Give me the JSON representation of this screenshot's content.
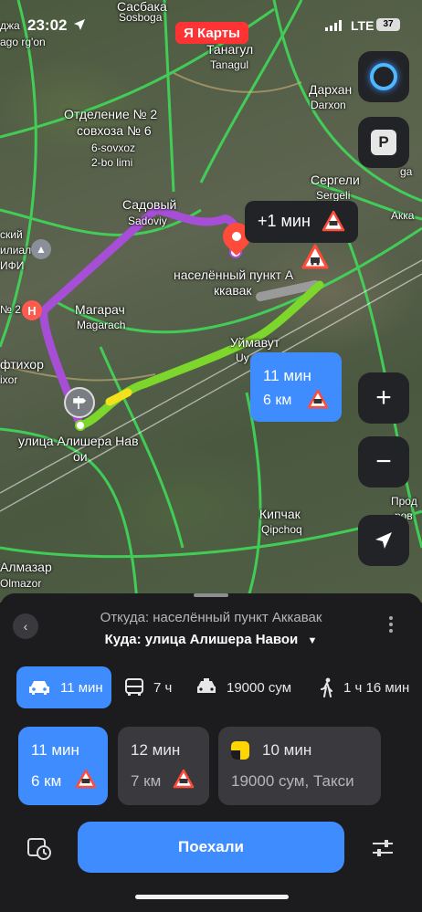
{
  "status_bar": {
    "time": "23:02",
    "network": "LTE",
    "battery": "37"
  },
  "app_logo": "Я Карты",
  "map": {
    "labels": {
      "sasbaka": "Сасбака",
      "sosboga": "Sosboga",
      "tanagul": "Танагул",
      "tanagul_lat": "Tanagul",
      "darkhan": "Дархан",
      "darxon": "Darxon",
      "ago_rgon": "ago rg'on",
      "dzha": "джа",
      "otdelenie1": "Отделение № 2",
      "otdelenie2": "совхоза № 6",
      "sovxoz1": "6-sovxoz",
      "sovxoz2": "2-bo limi",
      "sergeli": "Сергели",
      "sergeli_lat": "Sergeli",
      "akka": "Акка",
      "ga": "ga",
      "sadovy": "Садовый",
      "sadoviy": "Sadoviy",
      "skiy": "ский",
      "filial": "илиал",
      "ifi": "ИФИ",
      "magarach": "Магарач",
      "magarach_lat": "Magarach",
      "num2": "№ 2",
      "iftikhor": "фтихор",
      "ixor": "ixor",
      "uymavut": "Уймавут",
      "uy": "Uy",
      "street1": "улица Алишера Нав",
      "street2": "ои",
      "kipchak": "Кипчак",
      "qipchoq": "Qipchoq",
      "almazar": "Алмазар",
      "olmazor": "Olmazor",
      "prod": "Прод",
      "rod": "ров",
      "settlement1": "населённый пункт А",
      "settlement2": "ккавак"
    },
    "alt_route_bubble": "+1 мин",
    "route_bubble": {
      "time": "11 мин",
      "distance": "6 км"
    },
    "buttons": {
      "zoom_in": "+",
      "zoom_out": "−",
      "parking": "P"
    }
  },
  "panel": {
    "from": "Откуда: населённый пункт Аккавак",
    "to": "Куда: улица Алишера Навои",
    "tabs": [
      {
        "label": "11 мин",
        "icon": "car-icon"
      },
      {
        "label": "7 ч",
        "icon": "bus-icon"
      },
      {
        "label": "19000 сум",
        "icon": "taxi-icon"
      },
      {
        "label": "1 ч 16 мин",
        "icon": "walk-icon"
      }
    ],
    "routes": [
      {
        "time": "11 мин",
        "distance": "6 км"
      },
      {
        "time": "12 мин",
        "distance": "7 км"
      },
      {
        "time": "10 мин",
        "detail": "19000 сум, Такси"
      }
    ],
    "go_button": "Поехали"
  },
  "colors": {
    "accent": "#3f8cff",
    "route_main": "#7cd62b",
    "route_alt": "#a64fd6",
    "warn": "#ff4b3a"
  }
}
